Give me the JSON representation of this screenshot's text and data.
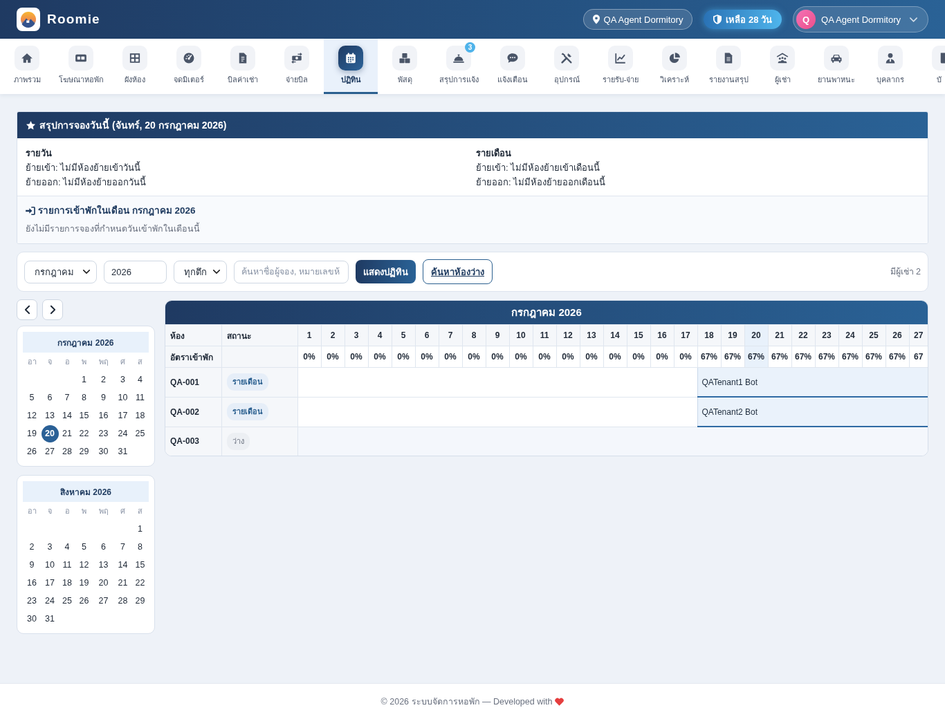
{
  "header": {
    "brand": "Roomie",
    "location": "QA Agent Dormitory",
    "trial": "เหลือ 28 วัน",
    "user": {
      "initial": "Q",
      "name": "QA Agent Dormitory"
    }
  },
  "nav": [
    {
      "label": "ภาพรวม",
      "selected": false
    },
    {
      "label": "โฆษณาหอพัก",
      "selected": false
    },
    {
      "label": "ผังห้อง",
      "selected": false
    },
    {
      "label": "จดมิเตอร์",
      "selected": false
    },
    {
      "label": "บิลค่าเช่า",
      "selected": false
    },
    {
      "label": "จ่ายบิล",
      "selected": false
    },
    {
      "label": "ปฏิทิน",
      "selected": true
    },
    {
      "label": "พัสดุ",
      "selected": false
    },
    {
      "label": "สรุปการแจ้ง",
      "selected": false,
      "badge": "3"
    },
    {
      "label": "แจ้งเตือน",
      "selected": false
    },
    {
      "label": "อุปกรณ์",
      "selected": false
    },
    {
      "label": "รายรับ-จ่าย",
      "selected": false
    },
    {
      "label": "วิเคราะห์",
      "selected": false
    },
    {
      "label": "รายงานสรุป",
      "selected": false
    },
    {
      "label": "ผู้เช่า",
      "selected": false
    },
    {
      "label": "ยานพาหนะ",
      "selected": false
    },
    {
      "label": "บุคลากร",
      "selected": false
    },
    {
      "label": "บั",
      "selected": false
    }
  ],
  "summary": {
    "title": "สรุปการจองวันนี้ (จันทร์, 20 กรกฎาคม 2026)",
    "columns": [
      {
        "heading": "รายวัน",
        "lines": [
          "ย้ายเข้า: ไม่มีห้องย้ายเข้าวันนี้",
          "ย้ายออก: ไม่มีห้องย้ายออกวันนี้"
        ]
      },
      {
        "heading": "รายเดือน",
        "lines": [
          "ย้ายเข้า: ไม่มีห้องย้ายเข้าเดือนนี้",
          "ย้ายออก: ไม่มีห้องย้ายออกเดือนนี้"
        ]
      }
    ],
    "checkins": {
      "title": "รายการเข้าพักในเดือน กรกฎาคม 2026",
      "empty": "ยังไม่มีรายการจองที่กำหนดวันเข้าพักในเดือนนี้"
    }
  },
  "filters": {
    "month": "กรกฎาคม",
    "year": "2026",
    "building": "ทุกตึก",
    "search": {
      "placeholder": "ค้นหาชื่อผู้จอง, หมายเลขห้"
    },
    "buttons": [
      {
        "label": "แสดงปฏิทิน",
        "kind": "primary"
      },
      {
        "label": "ค้นหาห้องว่าง",
        "kind": "outline"
      }
    ],
    "tenant_count": "มีผู้เช่า 2"
  },
  "mini_calendars": [
    {
      "title": "กรกฎาคม 2026",
      "weekdays": [
        "อา",
        "จ",
        "อ",
        "พ",
        "พฤ",
        "ศ",
        "ส"
      ],
      "weeks": [
        [
          {
            "day": "1",
            "selected": false
          },
          {
            "day": "2",
            "selected": false
          },
          {
            "day": "3",
            "selected": false
          },
          {
            "day": "4",
            "selected": false
          }
        ],
        [
          {
            "day": "5",
            "selected": false
          },
          {
            "day": "6",
            "selected": false
          },
          {
            "day": "7",
            "selected": false
          },
          {
            "day": "8",
            "selected": false
          },
          {
            "day": "9",
            "selected": false
          },
          {
            "day": "10",
            "selected": false
          },
          {
            "day": "11",
            "selected": false
          }
        ],
        [
          {
            "day": "12",
            "selected": false
          },
          {
            "day": "13",
            "selected": false
          },
          {
            "day": "14",
            "selected": false
          },
          {
            "day": "15",
            "selected": false
          },
          {
            "day": "16",
            "selected": false
          },
          {
            "day": "17",
            "selected": false
          },
          {
            "day": "18",
            "selected": false
          }
        ],
        [
          {
            "day": "19",
            "selected": false
          },
          {
            "day": "20",
            "selected": true
          },
          {
            "day": "21",
            "selected": false
          },
          {
            "day": "22",
            "selected": false
          },
          {
            "day": "23",
            "selected": false
          },
          {
            "day": "24",
            "selected": false
          },
          {
            "day": "25",
            "selected": false
          }
        ],
        [
          {
            "day": "26",
            "selected": false
          },
          {
            "day": "27",
            "selected": false
          },
          {
            "day": "28",
            "selected": false
          },
          {
            "day": "29",
            "selected": false
          },
          {
            "day": "30",
            "selected": false
          },
          {
            "day": "31",
            "selected": false
          }
        ]
      ]
    },
    {
      "title": "สิงหาคม 2026",
      "weekdays": [
        "อา",
        "จ",
        "อ",
        "พ",
        "พฤ",
        "ศ",
        "ส"
      ],
      "weeks": [
        [
          {
            "day": "1",
            "selected": false
          }
        ],
        [
          {
            "day": "2",
            "selected": false
          },
          {
            "day": "3",
            "selected": false
          },
          {
            "day": "4",
            "selected": false
          },
          {
            "day": "5",
            "selected": false
          },
          {
            "day": "6",
            "selected": false
          },
          {
            "day": "7",
            "selected": false
          },
          {
            "day": "8",
            "selected": false
          }
        ],
        [
          {
            "day": "9",
            "selected": false
          },
          {
            "day": "10",
            "selected": false
          },
          {
            "day": "11",
            "selected": false
          },
          {
            "day": "12",
            "selected": false
          },
          {
            "day": "13",
            "selected": false
          },
          {
            "day": "14",
            "selected": false
          },
          {
            "day": "15",
            "selected": false
          }
        ],
        [
          {
            "day": "16",
            "selected": false
          },
          {
            "day": "17",
            "selected": false
          },
          {
            "day": "18",
            "selected": false
          },
          {
            "day": "19",
            "selected": false
          },
          {
            "day": "20",
            "selected": false
          },
          {
            "day": "21",
            "selected": false
          },
          {
            "day": "22",
            "selected": false
          }
        ],
        [
          {
            "day": "23",
            "selected": false
          },
          {
            "day": "24",
            "selected": false
          },
          {
            "day": "25",
            "selected": false
          },
          {
            "day": "26",
            "selected": false
          },
          {
            "day": "27",
            "selected": false
          },
          {
            "day": "28",
            "selected": false
          },
          {
            "day": "29",
            "selected": false
          }
        ],
        [
          {
            "day": "30",
            "selected": false
          },
          {
            "day": "31",
            "selected": false
          }
        ]
      ]
    }
  ],
  "grid": {
    "title": "กรกฎาคม 2026",
    "room_header": "ห้อง",
    "status_header": "สถานะ",
    "rate_label": "อัตราเข้าพัก",
    "days": [
      {
        "label": "1",
        "rate": "0%",
        "today": false
      },
      {
        "label": "2",
        "rate": "0%",
        "today": false
      },
      {
        "label": "3",
        "rate": "0%",
        "today": false
      },
      {
        "label": "4",
        "rate": "0%",
        "today": false
      },
      {
        "label": "5",
        "rate": "0%",
        "today": false
      },
      {
        "label": "6",
        "rate": "0%",
        "today": false
      },
      {
        "label": "7",
        "rate": "0%",
        "today": false
      },
      {
        "label": "8",
        "rate": "0%",
        "today": false
      },
      {
        "label": "9",
        "rate": "0%",
        "today": false
      },
      {
        "label": "10",
        "rate": "0%",
        "today": false
      },
      {
        "label": "11",
        "rate": "0%",
        "today": false
      },
      {
        "label": "12",
        "rate": "0%",
        "today": false
      },
      {
        "label": "13",
        "rate": "0%",
        "today": false
      },
      {
        "label": "14",
        "rate": "0%",
        "today": false
      },
      {
        "label": "15",
        "rate": "0%",
        "today": false
      },
      {
        "label": "16",
        "rate": "0%",
        "today": false
      },
      {
        "label": "17",
        "rate": "0%",
        "today": false
      },
      {
        "label": "18",
        "rate": "67%",
        "today": false
      },
      {
        "label": "19",
        "rate": "67%",
        "today": false
      },
      {
        "label": "20",
        "rate": "67%",
        "today": true
      },
      {
        "label": "21",
        "rate": "67%",
        "today": false
      },
      {
        "label": "22",
        "rate": "67%",
        "today": false
      },
      {
        "label": "23",
        "rate": "67%",
        "today": false
      },
      {
        "label": "24",
        "rate": "67%",
        "today": false
      },
      {
        "label": "25",
        "rate": "67%",
        "today": false
      },
      {
        "label": "26",
        "rate": "67%",
        "today": false
      },
      {
        "label": "27",
        "rate": "67",
        "today": false
      }
    ],
    "rooms": [
      {
        "room": "QA-001",
        "status": {
          "label": "รายเดือน",
          "kind": "monthly"
        },
        "tenant": "QATenant1 Bot",
        "occupied": [
          false,
          false,
          false,
          false,
          false,
          false,
          false,
          false,
          false,
          false,
          false,
          false,
          false,
          false,
          false,
          false,
          false,
          true,
          true,
          true,
          true,
          true,
          true,
          true,
          true,
          true,
          true
        ]
      },
      {
        "room": "QA-002",
        "status": {
          "label": "รายเดือน",
          "kind": "monthly"
        },
        "tenant": "QATenant2 Bot",
        "occupied": [
          false,
          false,
          false,
          false,
          false,
          false,
          false,
          false,
          false,
          false,
          false,
          false,
          false,
          false,
          false,
          false,
          false,
          true,
          true,
          true,
          true,
          true,
          true,
          true,
          true,
          true,
          true
        ]
      },
      {
        "room": "QA-003",
        "status": {
          "label": "ว่าง",
          "kind": "vacant"
        },
        "occupied": [
          false,
          false,
          false,
          false,
          false,
          false,
          false,
          false,
          false,
          false,
          false,
          false,
          false,
          false,
          false,
          false,
          false,
          false,
          false,
          false,
          false,
          false,
          false,
          false,
          false,
          false,
          false
        ]
      }
    ]
  },
  "footer": {
    "text": "© 2026 ระบบจัดการหอพัก — Developed with"
  }
}
